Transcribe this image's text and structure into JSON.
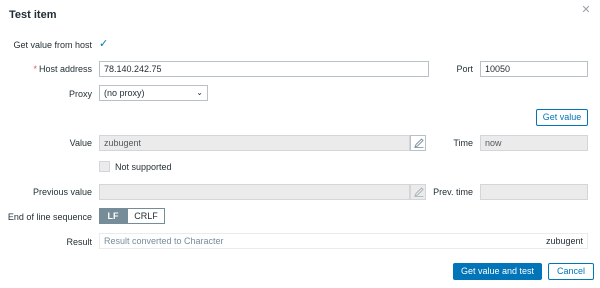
{
  "dialog": {
    "title": "Test item",
    "close_icon": "close-icon"
  },
  "form": {
    "get_value_from_host": {
      "label": "Get value from host",
      "checked": true
    },
    "host_address": {
      "label": "Host address",
      "required": true,
      "value": "78.140.242.75"
    },
    "port": {
      "label": "Port",
      "value": "10050"
    },
    "proxy": {
      "label": "Proxy",
      "selected": "(no proxy)"
    },
    "get_value_button": "Get value",
    "value": {
      "label": "Value",
      "value": "zubugent"
    },
    "time": {
      "label": "Time",
      "value": "now"
    },
    "not_supported": {
      "label": "Not supported",
      "checked": false
    },
    "previous_value": {
      "label": "Previous value",
      "value": ""
    },
    "prev_time": {
      "label": "Prev. time",
      "value": ""
    },
    "eol": {
      "label": "End of line sequence",
      "options": [
        "LF",
        "CRLF"
      ],
      "selected": "LF"
    },
    "result": {
      "label": "Result",
      "description": "Result converted to Character",
      "value": "zubugent"
    }
  },
  "footer": {
    "submit_label": "Get value and test",
    "cancel_label": "Cancel"
  },
  "colors": {
    "accent": "#0275b8",
    "required": "#e45959",
    "segment_active": "#768d99"
  }
}
